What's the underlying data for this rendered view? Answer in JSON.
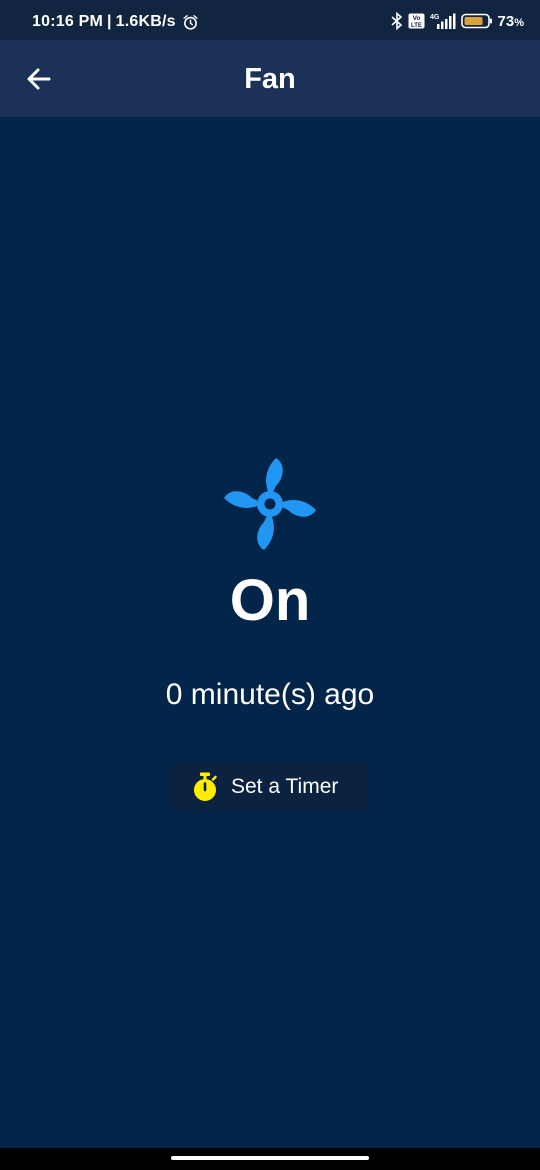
{
  "status_bar": {
    "time": "10:16 PM",
    "network_speed": "1.6KB/s",
    "separator": "|",
    "network_type": "4G",
    "battery_percent": "73",
    "battery_symbol": "%",
    "icons": [
      "alarm-icon",
      "bluetooth-icon",
      "volte-icon",
      "signal-icon",
      "battery-icon"
    ]
  },
  "app_bar": {
    "title": "Fan",
    "back_icon": "arrow-left-icon"
  },
  "device": {
    "icon": "fan-icon",
    "icon_color": "#2196f3",
    "state": "On",
    "last_changed": "0 minute(s) ago"
  },
  "timer_button": {
    "label": "Set a Timer",
    "icon": "stopwatch-icon",
    "icon_color": "#ffee00"
  },
  "colors": {
    "background": "#022549",
    "app_bar": "#1b3158",
    "status_bar": "#112541",
    "button_bg": "#0b2240"
  }
}
